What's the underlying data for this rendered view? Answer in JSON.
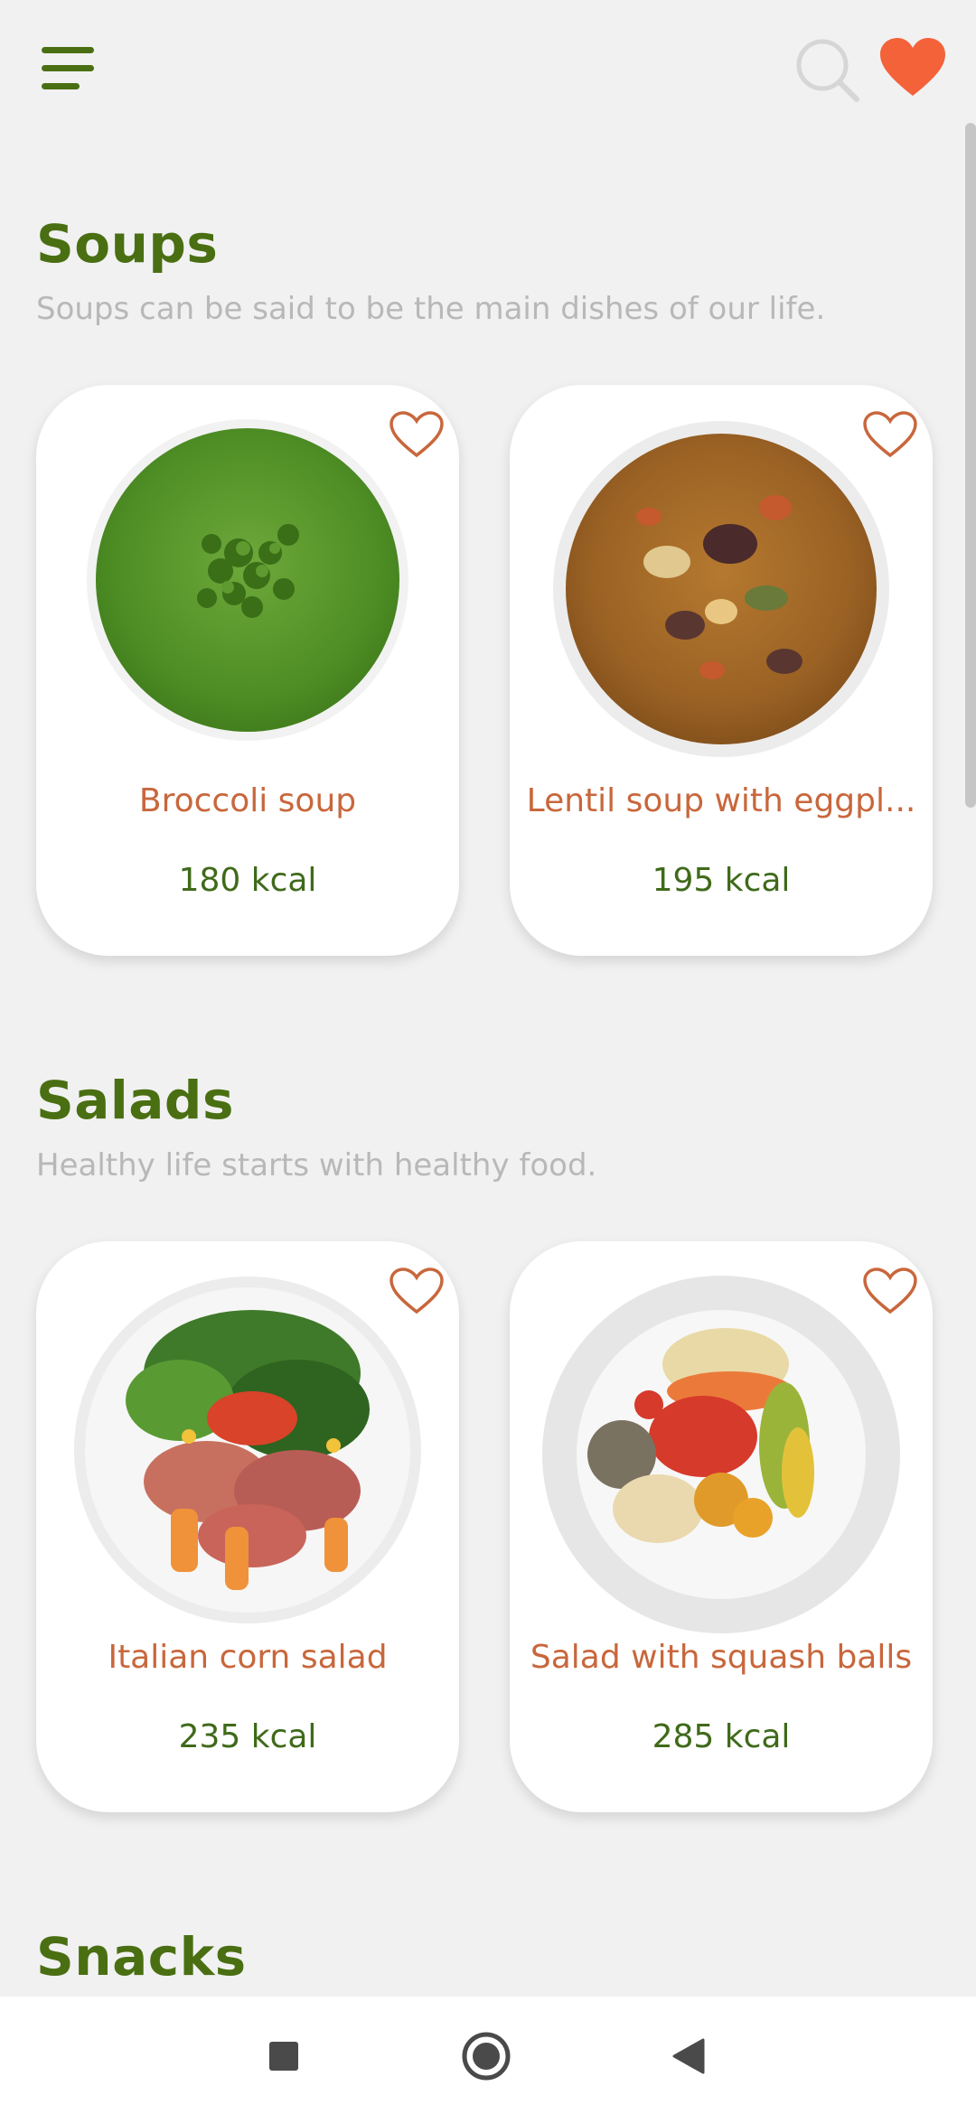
{
  "colors": {
    "accent_green": "#4a6f12",
    "accent_orange": "#c8673c",
    "heart_fill": "#f4623a",
    "background": "#f1f1f2"
  },
  "toolbar": {
    "menu_icon": "hamburger-menu-icon",
    "search_icon": "search-icon",
    "favorites_icon": "heart-filled-icon"
  },
  "sections": [
    {
      "title": "Soups",
      "subtitle": "Soups can be said to be the main dishes of our life.",
      "cards": [
        {
          "name": "Broccoli soup",
          "kcal": "180 kcal"
        },
        {
          "name": "Lentil soup with eggpl...",
          "kcal": "195 kcal"
        }
      ]
    },
    {
      "title": "Salads",
      "subtitle": "Healthy life starts with healthy food.",
      "cards": [
        {
          "name": "Italian corn salad",
          "kcal": "235 kcal"
        },
        {
          "name": "Salad with squash balls",
          "kcal": "285 kcal"
        }
      ]
    },
    {
      "title": "Snacks"
    }
  ],
  "navbar": {
    "recents_icon": "square-recents-icon",
    "home_icon": "circle-home-icon",
    "back_icon": "triangle-back-icon"
  }
}
